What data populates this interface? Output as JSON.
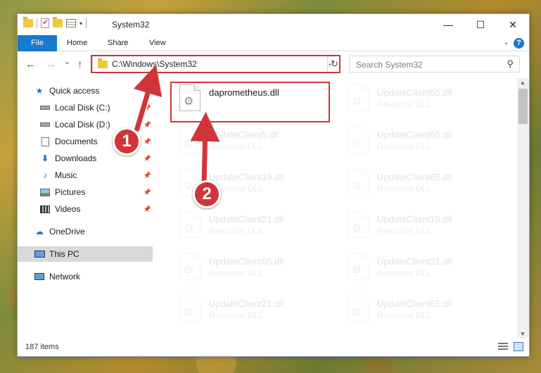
{
  "window": {
    "title": "System32",
    "controls": {
      "minimize": "—",
      "maximize": "☐",
      "close": "✕"
    }
  },
  "ribbon": {
    "tabs": [
      "File",
      "Home",
      "Share",
      "View"
    ],
    "help": "?"
  },
  "nav": {
    "back": "←",
    "forward": "→",
    "recent": "⌄",
    "up": "↑",
    "address": "C:\\Windows\\System32",
    "refresh": "↻",
    "search_placeholder": "Search System32"
  },
  "sidebar": {
    "items": [
      {
        "label": "Quick access",
        "icon": "star-icon"
      },
      {
        "label": "Local Disk (C:)",
        "icon": "drive-icon",
        "pinned": true
      },
      {
        "label": "Local Disk (D:)",
        "icon": "drive-icon",
        "pinned": true
      },
      {
        "label": "Documents",
        "icon": "documents-icon",
        "pinned": true
      },
      {
        "label": "Downloads",
        "icon": "download-icon",
        "pinned": true
      },
      {
        "label": "Music",
        "icon": "music-icon",
        "pinned": true
      },
      {
        "label": "Pictures",
        "icon": "pictures-icon",
        "pinned": true
      },
      {
        "label": "Videos",
        "icon": "videos-icon",
        "pinned": true
      },
      {
        "label": "OneDrive",
        "icon": "cloud-icon"
      },
      {
        "label": "This PC",
        "icon": "computer-icon",
        "selected": true
      },
      {
        "label": "Network",
        "icon": "network-icon"
      }
    ]
  },
  "files": [
    {
      "name": "daprometheus.dll",
      "type": ""
    },
    {
      "name": "UpdateClient65.dll",
      "type": "Resource DLL"
    },
    {
      "name": "UpdateClient5.dll",
      "type": "Resource DLL"
    },
    {
      "name": "UpdateClient65.dll",
      "type": "Resource DLL"
    },
    {
      "name": "UpdateClient19.dll",
      "type": "Resource DLL"
    },
    {
      "name": "UpdateClient65.dll",
      "type": "Resource DLL"
    },
    {
      "name": "UpdateClient21.dll",
      "type": "Resource DLL"
    },
    {
      "name": "UpdateClient19.dll",
      "type": "Resource DLL"
    },
    {
      "name": "UpdateClient65.dll",
      "type": "Resource DLL"
    },
    {
      "name": "UpdateClient21.dll",
      "type": "Resource DLL"
    },
    {
      "name": "UpdateClient21.dll",
      "type": "Resource DLL"
    },
    {
      "name": "UpdateClient65.dll",
      "type": "Resource DLL"
    }
  ],
  "status": {
    "item_count": "187 items"
  },
  "annotations": {
    "step1": "1",
    "step2": "2",
    "color": "#d0353a"
  }
}
